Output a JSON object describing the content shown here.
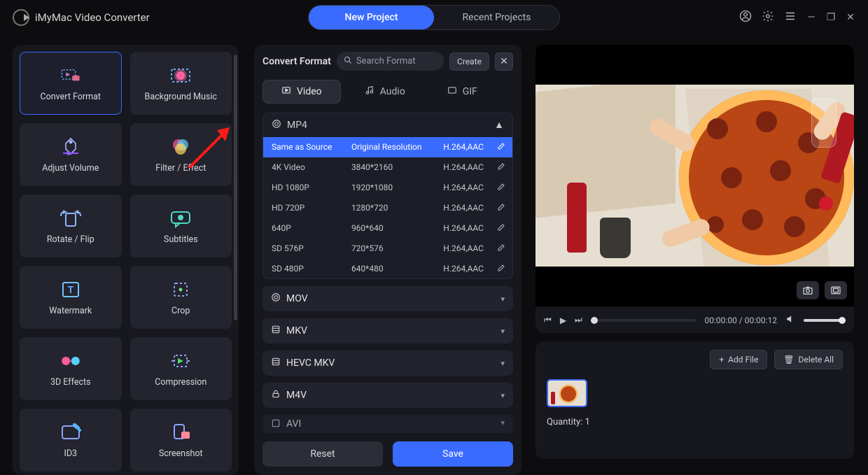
{
  "app": {
    "title": "iMyMac Video Converter"
  },
  "top_tabs": {
    "new_project": "New Project",
    "recent_projects": "Recent Projects"
  },
  "tools": {
    "items": [
      {
        "label": "Convert Format"
      },
      {
        "label": "Background Music"
      },
      {
        "label": "Adjust Volume"
      },
      {
        "label": "Filter / Effect"
      },
      {
        "label": "Rotate / Flip"
      },
      {
        "label": "Subtitles"
      },
      {
        "label": "Watermark"
      },
      {
        "label": "Crop"
      },
      {
        "label": "3D Effects"
      },
      {
        "label": "Compression"
      },
      {
        "label": "ID3"
      },
      {
        "label": "Screenshot"
      }
    ]
  },
  "format_panel": {
    "title": "Convert Format",
    "search_placeholder": "Search Format",
    "create": "Create",
    "tabs": {
      "video": "Video",
      "audio": "Audio",
      "gif": "GIF"
    },
    "groups": {
      "mp4": "MP4",
      "mov": "MOV",
      "mkv": "MKV",
      "hevc_mkv": "HEVC MKV",
      "m4v": "M4V",
      "avi": "AVI"
    },
    "mp4_rows": [
      {
        "name": "Same as Source",
        "res": "Original Resolution",
        "codec": "H.264,AAC"
      },
      {
        "name": "4K Video",
        "res": "3840*2160",
        "codec": "H.264,AAC"
      },
      {
        "name": "HD 1080P",
        "res": "1920*1080",
        "codec": "H.264,AAC"
      },
      {
        "name": "HD 720P",
        "res": "1280*720",
        "codec": "H.264,AAC"
      },
      {
        "name": "640P",
        "res": "960*640",
        "codec": "H.264,AAC"
      },
      {
        "name": "SD 576P",
        "res": "720*576",
        "codec": "H.264,AAC"
      },
      {
        "name": "SD 480P",
        "res": "640*480",
        "codec": "H.264,AAC"
      }
    ],
    "reset": "Reset",
    "save": "Save"
  },
  "preview": {
    "time_current": "00:00:00",
    "time_sep": " / ",
    "time_total": "00:00:12"
  },
  "queue": {
    "add_file": "Add File",
    "delete_all": "Delete All",
    "quantity_label": "Quantity: 1"
  },
  "icons": {
    "plus": "+",
    "trash": "🗑"
  }
}
